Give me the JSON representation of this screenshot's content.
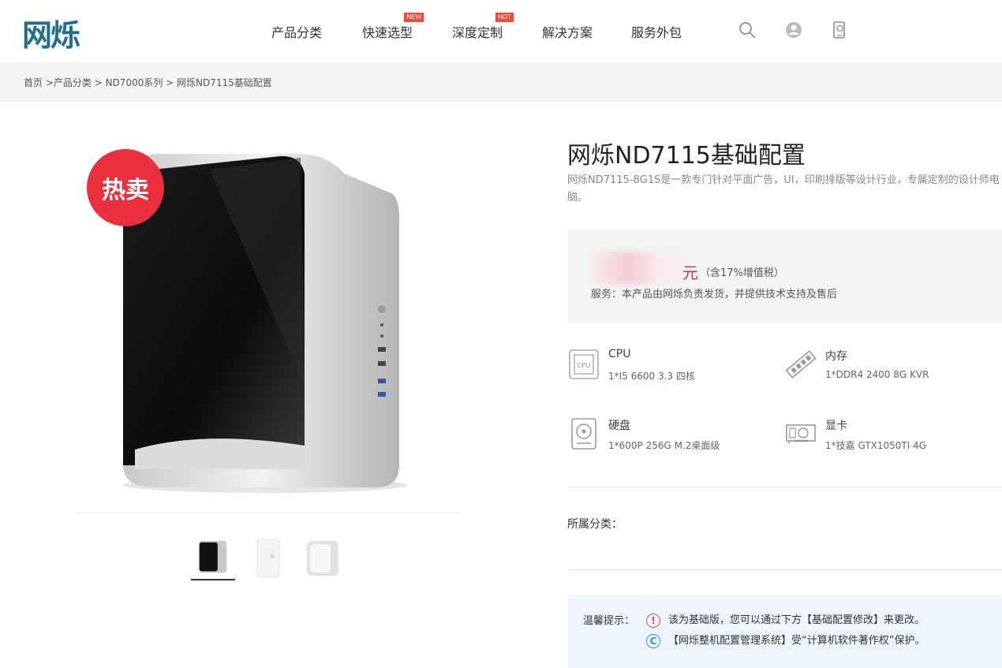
{
  "header": {
    "logo": "网烁",
    "nav": [
      {
        "label": "产品分类",
        "badge": ""
      },
      {
        "label": "快速选型",
        "badge": "NEW"
      },
      {
        "label": "深度定制",
        "badge": "HOT"
      },
      {
        "label": "解决方案",
        "badge": ""
      },
      {
        "label": "服务外包",
        "badge": ""
      }
    ],
    "icons": [
      "search-icon",
      "user-icon",
      "phone-icon"
    ]
  },
  "breadcrumb": {
    "home": "首页",
    "sep1": " >",
    "category": "产品分类",
    "sep2": " > ",
    "series": "ND7000系列",
    "sep3": " > ",
    "current": "网烁ND7115基础配置"
  },
  "gallery": {
    "hot_badge": "热卖",
    "thumbnails": [
      "black-case",
      "white-case",
      "silver-case"
    ]
  },
  "product": {
    "title": "网烁ND7115基础配置",
    "description": "网烁ND7115-8G1S是一款专门针对平面广告，UI，印刷排版等设计行业，专属定制的设计师电脑。",
    "price_unit": "元",
    "price_tax": "（含17%增值税）",
    "service": "服务：本产品由网烁负责发货，并提供技术支持及售后",
    "specs": [
      {
        "name": "CPU",
        "value": "1*I5 6600 3.3 四核",
        "icon": "cpu-icon"
      },
      {
        "name": "内存",
        "value": "1*DDR4 2400 8G KVR",
        "icon": "memory-icon"
      },
      {
        "name": "硬盘",
        "value": "1*600P 256G M.2桌面级",
        "icon": "disk-icon"
      },
      {
        "name": "显卡",
        "value": "1*技嘉 GTX1050TI 4G",
        "icon": "gpu-icon"
      }
    ],
    "category_label": "所属分类："
  },
  "tips": {
    "label": "温馨提示：",
    "line1": "该为基础版，您可以通过下方【基础配置修改】来更改。",
    "line2": "【网烁整机配置管理系统】受“计算机软件著作权”保护。",
    "warn_glyph": "!",
    "copy_glyph": "C"
  },
  "colors": {
    "brand": "#1e6e8c",
    "accent_red": "#e8303f",
    "tip_bg": "#edf6fc"
  }
}
